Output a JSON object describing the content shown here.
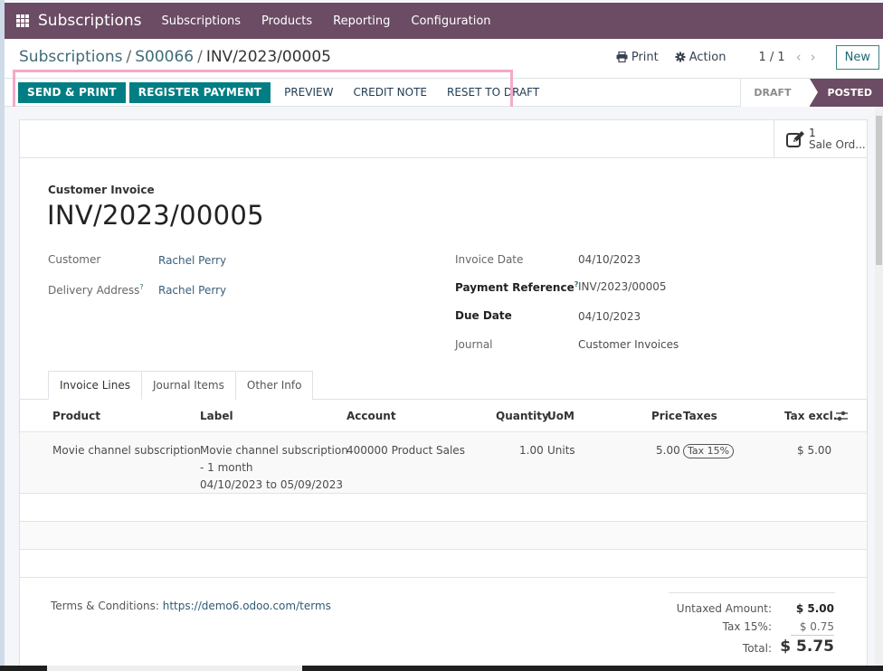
{
  "navbar": {
    "app_name": "Subscriptions",
    "menu": [
      "Subscriptions",
      "Products",
      "Reporting",
      "Configuration"
    ]
  },
  "breadcrumb": {
    "items": [
      "Subscriptions",
      "S00066"
    ],
    "current": "INV/2023/00005",
    "separator": "/"
  },
  "control": {
    "print_label": "Print",
    "action_label": "Action",
    "pager": "1 / 1",
    "new_label": "New"
  },
  "statusbar": {
    "buttons": {
      "send_print": "SEND & PRINT",
      "register_payment": "REGISTER PAYMENT",
      "preview": "PREVIEW",
      "credit_note": "CREDIT NOTE",
      "reset_to_draft": "RESET TO DRAFT"
    },
    "stages": [
      "DRAFT",
      "POSTED"
    ],
    "current_stage": "POSTED",
    "highlight_color": "#f4aac8"
  },
  "smart_button": {
    "count": "1",
    "label": "Sale Ord..."
  },
  "invoice": {
    "type": "Customer Invoice",
    "name": "INV/2023/00005",
    "customer_label": "Customer",
    "customer": "Rachel Perry",
    "delivery_label": "Delivery Address",
    "delivery": "Rachel Perry",
    "invoice_date_label": "Invoice Date",
    "invoice_date": "04/10/2023",
    "payment_ref_label": "Payment Reference",
    "payment_ref": "INV/2023/00005",
    "due_date_label": "Due Date",
    "due_date": "04/10/2023",
    "journal_label": "Journal",
    "journal": "Customer Invoices",
    "help_mark": "?"
  },
  "tabs": [
    "Invoice Lines",
    "Journal Items",
    "Other Info"
  ],
  "active_tab": "Invoice Lines",
  "table": {
    "columns": [
      "Product",
      "Label",
      "Account",
      "Quantity",
      "UoM",
      "Price",
      "Taxes",
      "Tax excl."
    ],
    "rows": [
      {
        "product": "Movie channel subscription",
        "label_line1": "Movie channel subscription",
        "label_line2": "- 1 month",
        "label_line3": "04/10/2023 to 05/09/2023",
        "account": "400000 Product Sales",
        "quantity": "1.00",
        "uom": "Units",
        "price": "5.00",
        "taxes": "Tax 15%",
        "subtotal": "$ 5.00"
      }
    ]
  },
  "footer": {
    "terms_label": "Terms & Conditions:",
    "terms_link": "https://demo6.odoo.com/terms",
    "untaxed_label": "Untaxed Amount:",
    "untaxed": "$ 5.00",
    "tax_label": "Tax 15%:",
    "tax": "$ 0.75",
    "total_label": "Total:",
    "total": "$ 5.75"
  },
  "colors": {
    "brand": "#6b4c64",
    "primary": "#017e84",
    "link": "#3b5f7a"
  }
}
